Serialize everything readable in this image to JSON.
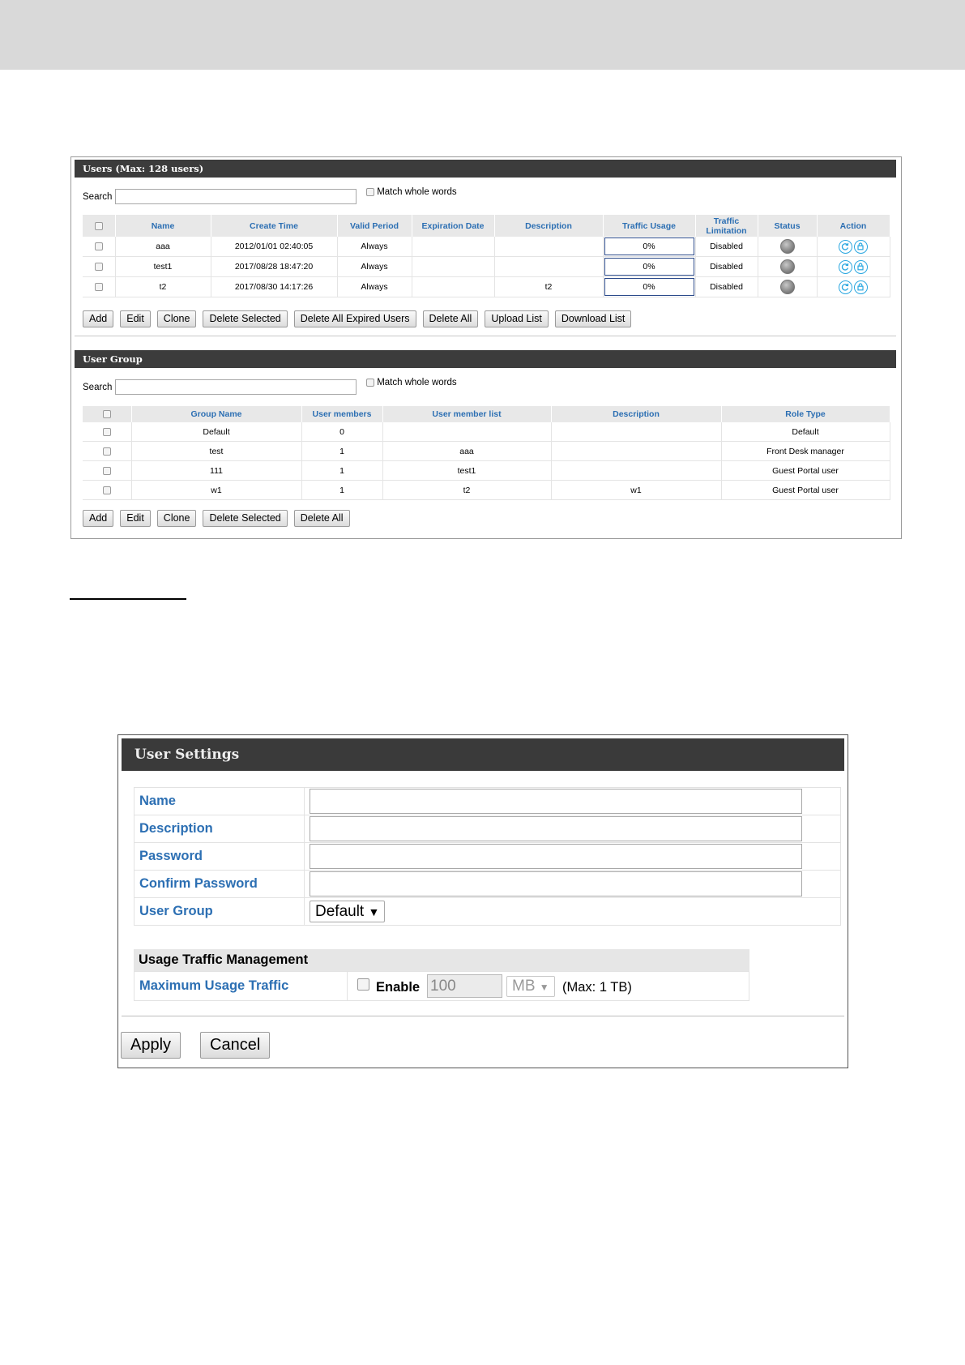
{
  "users_panel": {
    "title": "Users (Max: 128 users)",
    "search_label": "Search",
    "search_value": "",
    "match_whole_words": "Match whole words",
    "columns": [
      "Name",
      "Create Time",
      "Valid Period",
      "Expiration Date",
      "Description",
      "Traffic Usage",
      "Traffic Limitation",
      "Status",
      "Action"
    ],
    "rows": [
      {
        "name": "aaa",
        "create_time": "2012/01/01 02:40:05",
        "valid_period": "Always",
        "expiration_date": "",
        "description": "",
        "traffic_usage": "0%",
        "traffic_limitation": "Disabled"
      },
      {
        "name": "test1",
        "create_time": "2017/08/28 18:47:20",
        "valid_period": "Always",
        "expiration_date": "",
        "description": "",
        "traffic_usage": "0%",
        "traffic_limitation": "Disabled"
      },
      {
        "name": "t2",
        "create_time": "2017/08/30 14:17:26",
        "valid_period": "Always",
        "expiration_date": "",
        "description": "t2",
        "traffic_usage": "0%",
        "traffic_limitation": "Disabled"
      }
    ],
    "buttons": [
      "Add",
      "Edit",
      "Clone",
      "Delete Selected",
      "Delete All Expired Users",
      "Delete All",
      "Upload List",
      "Download List"
    ]
  },
  "group_panel": {
    "title": "User Group",
    "search_label": "Search",
    "search_value": "",
    "match_whole_words": "Match whole words",
    "columns": [
      "Group Name",
      "User members",
      "User member list",
      "Description",
      "Role Type"
    ],
    "rows": [
      {
        "group_name": "Default",
        "members": "0",
        "member_list": "",
        "description": "",
        "role_type": "Default"
      },
      {
        "group_name": "test",
        "members": "1",
        "member_list": "aaa",
        "description": "",
        "role_type": "Front Desk manager"
      },
      {
        "group_name": "111",
        "members": "1",
        "member_list": "test1",
        "description": "",
        "role_type": "Guest Portal user"
      },
      {
        "group_name": "w1",
        "members": "1",
        "member_list": "t2",
        "description": "w1",
        "role_type": "Guest Portal user"
      }
    ],
    "buttons": [
      "Add",
      "Edit",
      "Clone",
      "Delete Selected",
      "Delete All"
    ]
  },
  "user_settings": {
    "title": "User Settings",
    "fields": [
      {
        "label": "Name",
        "value": ""
      },
      {
        "label": "Description",
        "value": ""
      },
      {
        "label": "Password",
        "value": ""
      },
      {
        "label": "Confirm Password",
        "value": ""
      }
    ],
    "user_group_label": "User Group",
    "user_group_value": "Default",
    "usage_header": "Usage Traffic Management",
    "max_usage_label": "Maximum Usage Traffic",
    "enable_label": "Enable",
    "usage_value": "100",
    "unit_value": "MB",
    "max_note": "(Max: 1 TB)",
    "apply_label": "Apply",
    "cancel_label": "Cancel"
  },
  "icons": {
    "status": "status-indicator-icon",
    "action_edit": "refresh-icon",
    "action_lock": "lock-icon",
    "dropdown": "triangle-down-icon"
  },
  "colors": {
    "header_bar": "#3c3c3c",
    "label_blue": "#2c6fb3",
    "action_icon": "#2aa7e0"
  }
}
